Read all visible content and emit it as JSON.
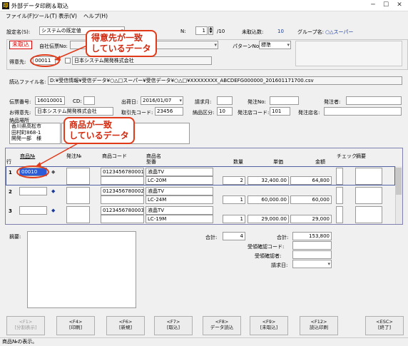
{
  "window": {
    "title": "外部データ印刷＆取込"
  },
  "menu": [
    "ファイル(F)",
    "ツール(T)",
    "表示(V)",
    "ヘルプ(H)"
  ],
  "header": {
    "setting_label": "設定名(S):",
    "setting_value": "システムの既定値",
    "page_label": "N:",
    "page_value": "1",
    "page_total": "/10",
    "unimported_label": "未取込数:",
    "unimported_value": "10",
    "group_label": "グループ名:",
    "group_value": "○△スーパー"
  },
  "status_tag": "未取込",
  "own_slip_label": "自社伝票No:",
  "pattern_label": "パターンNo:",
  "pattern_value": "標準",
  "customer_label": "得意先:",
  "customer_code": "00011",
  "customer_name": "日本システム開発株式会社",
  "file_label": "読込ファイル名:",
  "file_path": "D:¥受信情報¥受信データ¥○△□スーパー¥受信データ¥○△□¥XXXXXXXX_ABCDEFG000000_201601171700.csv",
  "slip": {
    "slip_no_label": "伝票番号:",
    "slip_no": "16010001",
    "cd_label": "CD:",
    "ship_date_label": "出荷日:",
    "ship_date": "2016/01/07",
    "invoice_label": "請求月:",
    "order_no_label": "発注No:",
    "orderer_label": "発注者:",
    "customer_label": "お得意先:",
    "customer": "日本システム開発株式会社",
    "dealer_label": "取引先コード:",
    "dealer_code": "23456",
    "delivery_type_label": "納品区分:",
    "delivery_type": "10",
    "order_store_label": "発注店コード:",
    "order_store": "101",
    "order_store_name_label": "発注店名:",
    "delivery_label": "納品場所",
    "address": [
      "香川県高松市",
      "田村町868-1",
      "開発一部　様"
    ]
  },
  "callouts": {
    "customer": "得意先が一致\nしているデータ",
    "product": "商品が一致\nしているデータ"
  },
  "grid": {
    "headers": {
      "row": "行",
      "product_no": "商品№",
      "order_no": "発注№",
      "product_code": "商品コード",
      "product_name": "商品名",
      "model": "型番",
      "qty": "数量",
      "unit_price": "単価",
      "amount": "金額",
      "check": "チェック",
      "summary": "摘要"
    },
    "rows": [
      {
        "no": "1",
        "product_no": "00010",
        "code": "0123456780001",
        "name": "液晶TV",
        "model": "LC-20M",
        "qty": "2",
        "price": "32,400.00",
        "amount": "64,800"
      },
      {
        "no": "2",
        "product_no": "",
        "code": "0123456780002",
        "name": "液晶TV",
        "model": "LC-24M",
        "qty": "1",
        "price": "60,000.00",
        "amount": "60,000"
      },
      {
        "no": "3",
        "product_no": "",
        "code": "0123456780003",
        "name": "液晶TV",
        "model": "LC-19M",
        "qty": "1",
        "price": "29,000.00",
        "amount": "29,000"
      }
    ]
  },
  "footer": {
    "memo_label": "摘要:",
    "total_label": "合計:",
    "total_qty": "4",
    "total_amount_label": "合計:",
    "total_amount": "153,800",
    "recv_code_label": "受領確認コード:",
    "recv_person_label": "受領確認者:",
    "invoice_date_label": "請求日:"
  },
  "fkeys": [
    {
      "key": "<F1>",
      "label": "[分割表示]",
      "disabled": true
    },
    {
      "key": "<F4>",
      "label": "[印刷]",
      "disabled": false
    },
    {
      "key": "<F6>",
      "label": "[新規]",
      "disabled": false
    },
    {
      "key": "<F7>",
      "label": "[取込]",
      "disabled": false
    },
    {
      "key": "<F8>",
      "label": "データ読込",
      "disabled": false
    },
    {
      "key": "<F9>",
      "label": "[未取込]",
      "disabled": false
    },
    {
      "key": "<F12>",
      "label": "読込印刷",
      "disabled": false
    },
    {
      "key": "<ESC>",
      "label": "[終了]",
      "disabled": false
    }
  ],
  "statusbar": "商品№の表示。"
}
